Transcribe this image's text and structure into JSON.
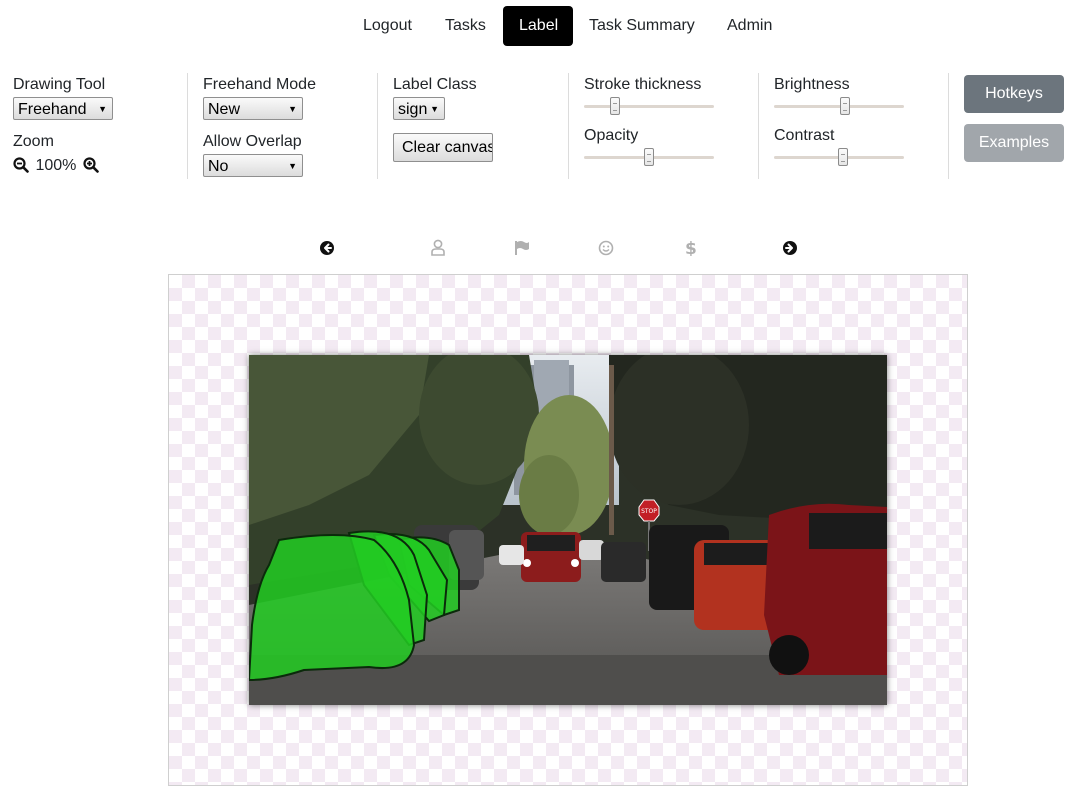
{
  "nav": {
    "items": [
      {
        "label": "Logout",
        "active": false
      },
      {
        "label": "Tasks",
        "active": false
      },
      {
        "label": "Label",
        "active": true
      },
      {
        "label": "Task Summary",
        "active": false
      },
      {
        "label": "Admin",
        "active": false
      }
    ]
  },
  "toolbar": {
    "drawing_tool": {
      "label": "Drawing Tool",
      "value": "Freehand"
    },
    "zoom": {
      "label": "Zoom",
      "value": "100%"
    },
    "freehand_mode": {
      "label": "Freehand Mode",
      "value": "New"
    },
    "allow_overlap": {
      "label": "Allow Overlap",
      "value": "No"
    },
    "label_class": {
      "label": "Label Class",
      "value": "sign"
    },
    "clear_canvas": {
      "label": "Clear canvas"
    },
    "stroke_thickness": {
      "label": "Stroke thickness",
      "level": 0.22
    },
    "opacity": {
      "label": "Opacity",
      "level": 0.5
    },
    "brightness": {
      "label": "Brightness",
      "level": 0.55
    },
    "contrast": {
      "label": "Contrast",
      "level": 0.53
    },
    "hotkeys": {
      "label": "Hotkeys"
    },
    "examples": {
      "label": "Examples"
    }
  },
  "task_nav": {
    "icons": [
      "arrow-left-circle-icon",
      "user-icon",
      "flag-icon",
      "smile-icon",
      "dollar-icon",
      "arrow-right-circle-icon"
    ]
  },
  "colors": {
    "nav_active_bg": "#000000",
    "hotkeys_bg": "#6c757d",
    "examples_bg": "#a1a6ab",
    "overlay_green": "#22cc22",
    "inactive_icon": "#b0b0b0"
  },
  "canvas": {
    "image_alt": "street scene",
    "stop_sign_text": "STOP"
  }
}
